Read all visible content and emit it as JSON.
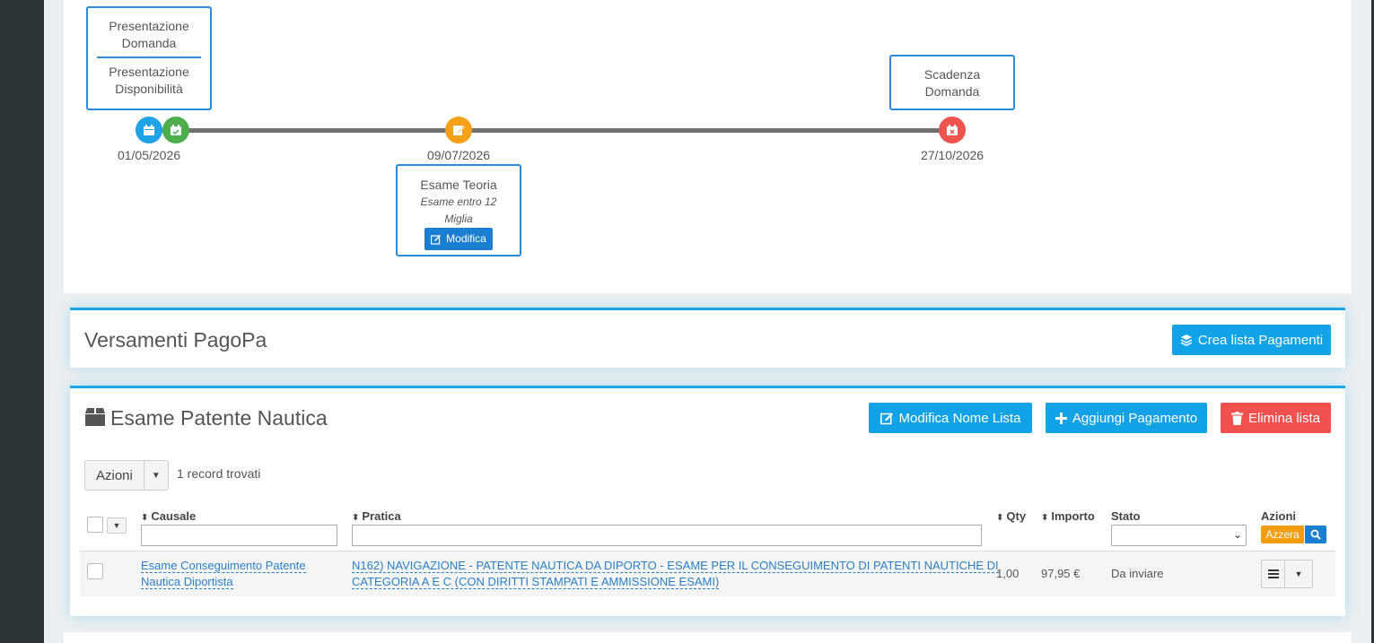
{
  "timeline": {
    "box1": {
      "line1": "Presentazione",
      "line2": "Domanda",
      "line3": "Presentazione",
      "line4": "Disponibilità"
    },
    "box2": {
      "line1": "Scadenza",
      "line2": "Domanda"
    },
    "box3": {
      "title": "Esame Teoria",
      "sub1": "Esame entro 12",
      "sub2": "Miglia",
      "button": "Modifica"
    },
    "dates": [
      "01/05/2026",
      "09/07/2026",
      "27/10/2026"
    ],
    "colors": {
      "blue": "#1ea3e6",
      "green": "#4cae4c",
      "orange": "#f5a017",
      "red": "#ef5350"
    },
    "icons": [
      "calendar-icon",
      "calendar-check-icon",
      "edit-icon",
      "calendar-times-icon"
    ]
  },
  "pagopa": {
    "title": "Versamenti PagoPa",
    "create_button": "Crea lista Pagamenti"
  },
  "list": {
    "title": "Esame Patente Nautica",
    "buttons": {
      "edit": "Modifica Nome Lista",
      "add": "Aggiungi Pagamento",
      "delete": "Elimina lista"
    },
    "azioni_label": "Azioni",
    "records_found": "1 record trovati",
    "columns": {
      "causale": "Causale",
      "pratica": "Pratica",
      "qty": "Qty",
      "importo": "Importo",
      "stato": "Stato",
      "azioni": "Azioni"
    },
    "reset_button": "Azzera",
    "rows": [
      {
        "causale_line1": "Esame Conseguimento Patente",
        "causale_line2": "Nautica Diportista",
        "pratica_line1": "N162) NAVIGAZIONE - PATENTE NAUTICA DA DIPORTO - ESAME PER IL CONSEGUIMENTO DI PATENTI NAUTICHE DI",
        "pratica_line2": "CATEGORIA A E C (CON DIRITTI STAMPATI E AMMISSIONE ESAMI)",
        "qty": "1,00",
        "importo": "97,95 €",
        "stato": "Da inviare"
      }
    ]
  }
}
